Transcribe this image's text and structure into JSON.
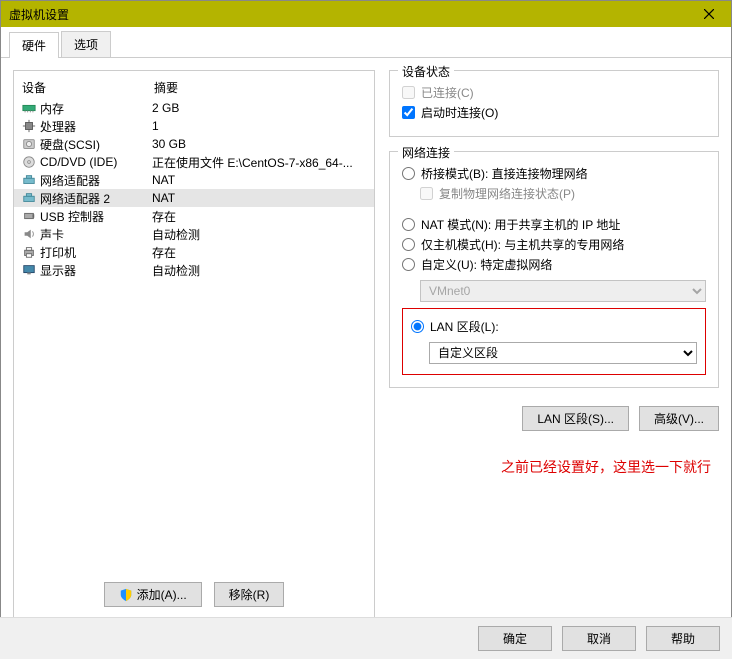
{
  "title": "虚拟机设置",
  "tabs": {
    "hardware": "硬件",
    "options": "选项"
  },
  "headers": {
    "device": "设备",
    "summary": "摘要"
  },
  "devices": [
    {
      "name": "内存",
      "summary": "2 GB",
      "icon": "memory"
    },
    {
      "name": "处理器",
      "summary": "1",
      "icon": "cpu"
    },
    {
      "name": "硬盘(SCSI)",
      "summary": "30 GB",
      "icon": "disk"
    },
    {
      "name": "CD/DVD (IDE)",
      "summary": "正在使用文件 E:\\CentOS-7-x86_64-...",
      "icon": "cd"
    },
    {
      "name": "网络适配器",
      "summary": "NAT",
      "icon": "net"
    },
    {
      "name": "网络适配器 2",
      "summary": "NAT",
      "icon": "net"
    },
    {
      "name": "USB 控制器",
      "summary": "存在",
      "icon": "usb"
    },
    {
      "name": "声卡",
      "summary": "自动检测",
      "icon": "sound"
    },
    {
      "name": "打印机",
      "summary": "存在",
      "icon": "printer"
    },
    {
      "name": "显示器",
      "summary": "自动检测",
      "icon": "display"
    }
  ],
  "leftButtons": {
    "add": "添加(A)...",
    "remove": "移除(R)"
  },
  "status": {
    "title": "设备状态",
    "connected": "已连接(C)",
    "connectOnStart": "启动时连接(O)"
  },
  "net": {
    "title": "网络连接",
    "bridged": "桥接模式(B): 直接连接物理网络",
    "replicate": "复制物理网络连接状态(P)",
    "nat": "NAT 模式(N): 用于共享主机的 IP 地址",
    "hostOnly": "仅主机模式(H): 与主机共享的专用网络",
    "custom": "自定义(U): 特定虚拟网络",
    "vmnet": "VMnet0",
    "lan": "LAN 区段(L):",
    "lanSelected": "自定义区段"
  },
  "rightButtons": {
    "lan": "LAN 区段(S)...",
    "advanced": "高级(V)..."
  },
  "annotation": "之前已经设置好，这里选一下就行",
  "footer": {
    "ok": "确定",
    "cancel": "取消",
    "help": "帮助"
  }
}
